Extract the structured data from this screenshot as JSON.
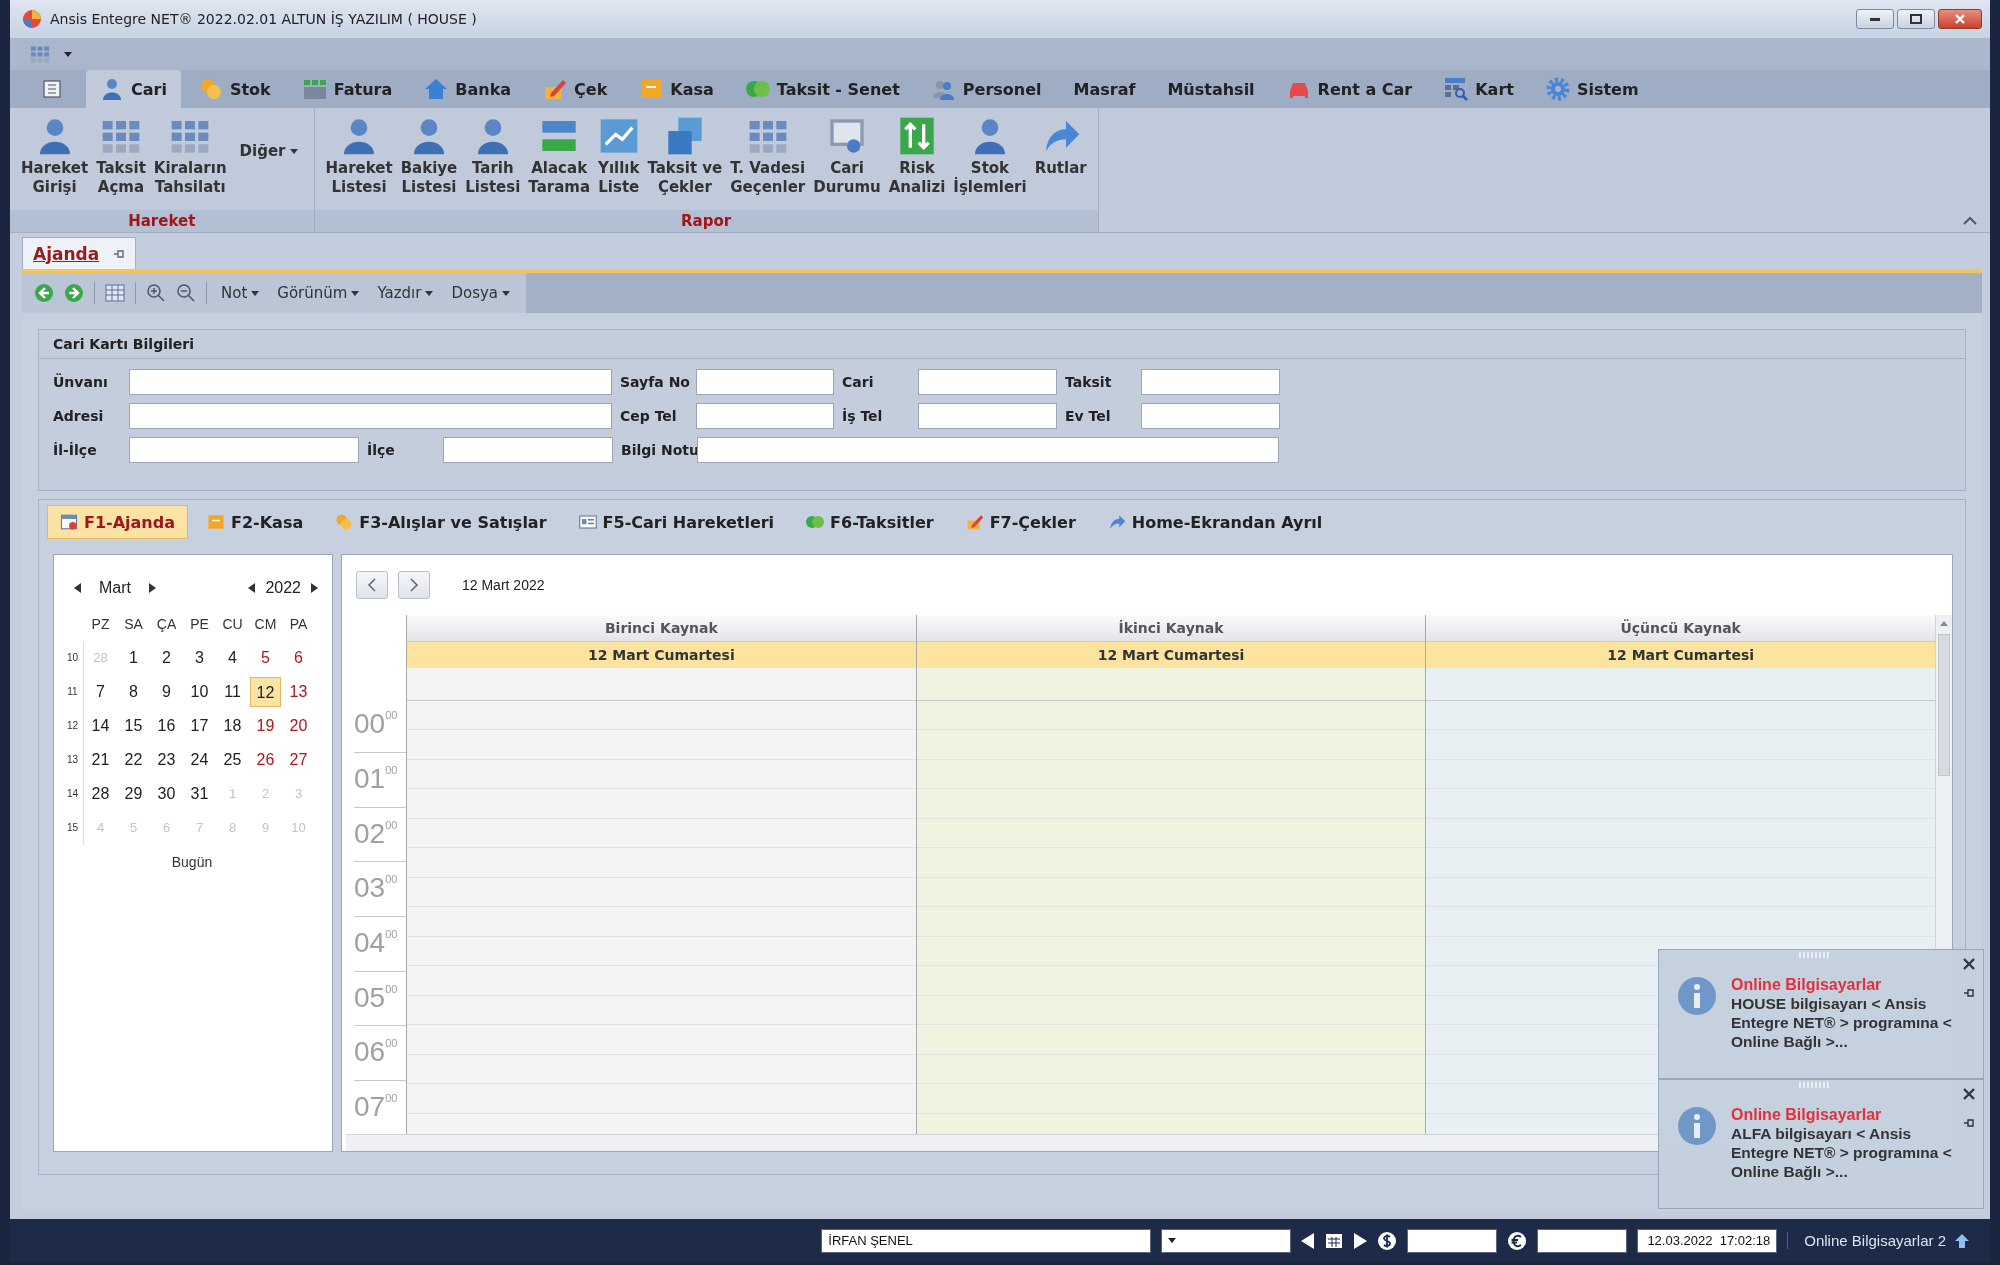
{
  "window": {
    "title": "Ansis Entegre NET® 2022.02.01 ALTUN İŞ YAZILIM ( HOUSE )"
  },
  "ribbon": {
    "tabs": [
      {
        "label": "Cari",
        "selected": true
      },
      {
        "label": "Stok",
        "selected": false
      },
      {
        "label": "Fatura",
        "selected": false
      },
      {
        "label": "Banka",
        "selected": false
      },
      {
        "label": "Çek",
        "selected": false
      },
      {
        "label": "Kasa",
        "selected": false
      },
      {
        "label": "Taksit - Senet",
        "selected": false
      },
      {
        "label": "Personel",
        "selected": false
      },
      {
        "label": "Masraf",
        "selected": false
      },
      {
        "label": "Müstahsil",
        "selected": false
      },
      {
        "label": "Rent a Car",
        "selected": false
      },
      {
        "label": "Kart",
        "selected": false
      },
      {
        "label": "Sistem",
        "selected": false
      }
    ],
    "groups": [
      {
        "label": "Hareket",
        "buttons": [
          {
            "kind": "large",
            "lines": [
              "Hareket",
              "Girişi"
            ]
          },
          {
            "kind": "large",
            "lines": [
              "Taksit",
              "Açma"
            ]
          },
          {
            "kind": "large",
            "lines": [
              "Kiraların",
              "Tahsilatı"
            ]
          },
          {
            "kind": "dropdown",
            "lines": [
              "Diğer"
            ]
          }
        ]
      },
      {
        "label": "Rapor",
        "buttons": [
          {
            "kind": "large",
            "lines": [
              "Hareket",
              "Listesi"
            ]
          },
          {
            "kind": "large",
            "lines": [
              "Bakiye",
              "Listesi"
            ]
          },
          {
            "kind": "large",
            "lines": [
              "Tarih",
              "Listesi"
            ]
          },
          {
            "kind": "large",
            "lines": [
              "Alacak",
              "Tarama"
            ]
          },
          {
            "kind": "large",
            "lines": [
              "Yıllık",
              "Liste"
            ]
          },
          {
            "kind": "large",
            "lines": [
              "Taksit ve",
              "Çekler"
            ]
          },
          {
            "kind": "large",
            "lines": [
              "T. Vadesi",
              "Geçenler"
            ]
          },
          {
            "kind": "large",
            "lines": [
              "Cari",
              "Durumu"
            ]
          },
          {
            "kind": "large",
            "lines": [
              "Risk",
              "Analizi"
            ]
          },
          {
            "kind": "large",
            "lines": [
              "Stok",
              "İşlemleri"
            ]
          },
          {
            "kind": "large",
            "lines": [
              "Rutlar"
            ]
          }
        ]
      }
    ]
  },
  "document_tab": {
    "label": "Ajanda",
    "selected": true
  },
  "toolbar": {
    "menus": [
      "Not",
      "Görünüm",
      "Yazdır",
      "Dosya"
    ]
  },
  "form": {
    "title": "Cari Kartı Bilgileri",
    "rows": [
      [
        {
          "label": "Ünvanı"
        },
        {
          "label": "Sayfa No"
        },
        {
          "label": "Cari"
        },
        {
          "label": "Taksit"
        }
      ],
      [
        {
          "label": "Adresi"
        },
        {
          "label": "Cep Tel"
        },
        {
          "label": "İş Tel"
        },
        {
          "label": "Ev Tel"
        }
      ],
      [
        {
          "label": "İl-İlçe",
          "sub": {
            "label": "İlçe"
          }
        },
        {
          "label": "Bilgi Notu"
        }
      ]
    ]
  },
  "tabs": [
    {
      "label": "F1-Ajanda",
      "selected": true
    },
    {
      "label": "F2-Kasa",
      "selected": false
    },
    {
      "label": "F3-Alışlar ve Satışlar",
      "selected": false
    },
    {
      "label": "F5-Cari Hareketleri",
      "selected": false
    },
    {
      "label": "F6-Taksitler",
      "selected": false
    },
    {
      "label": "F7-Çekler",
      "selected": false
    },
    {
      "label": "Home-Ekrandan Ayrıl",
      "selected": false
    }
  ],
  "calendar": {
    "month": "Mart",
    "year": "2022",
    "weekdays": [
      "PZ",
      "SA",
      "ÇA",
      "PE",
      "CU",
      "CM",
      "PA"
    ],
    "weeks": [
      {
        "number": "10",
        "days": [
          {
            "d": "28",
            "kind": "other",
            "selected": false
          },
          {
            "d": "1",
            "kind": "normal",
            "selected": false
          },
          {
            "d": "2",
            "kind": "normal",
            "selected": false
          },
          {
            "d": "3",
            "kind": "normal",
            "selected": false
          },
          {
            "d": "4",
            "kind": "normal",
            "selected": false
          },
          {
            "d": "5",
            "kind": "weekend",
            "selected": false
          },
          {
            "d": "6",
            "kind": "weekend",
            "selected": false
          }
        ]
      },
      {
        "number": "11",
        "days": [
          {
            "d": "7",
            "kind": "normal",
            "selected": false
          },
          {
            "d": "8",
            "kind": "normal",
            "selected": false
          },
          {
            "d": "9",
            "kind": "normal",
            "selected": false
          },
          {
            "d": "10",
            "kind": "normal",
            "selected": false
          },
          {
            "d": "11",
            "kind": "normal",
            "selected": false
          },
          {
            "d": "12",
            "kind": "normal",
            "selected": true
          },
          {
            "d": "13",
            "kind": "weekend",
            "selected": false
          }
        ]
      },
      {
        "number": "12",
        "days": [
          {
            "d": "14",
            "kind": "normal",
            "selected": false
          },
          {
            "d": "15",
            "kind": "normal",
            "selected": false
          },
          {
            "d": "16",
            "kind": "normal",
            "selected": false
          },
          {
            "d": "17",
            "kind": "normal",
            "selected": false
          },
          {
            "d": "18",
            "kind": "normal",
            "selected": false
          },
          {
            "d": "19",
            "kind": "weekend",
            "selected": false
          },
          {
            "d": "20",
            "kind": "weekend",
            "selected": false
          }
        ]
      },
      {
        "number": "13",
        "days": [
          {
            "d": "21",
            "kind": "normal",
            "selected": false
          },
          {
            "d": "22",
            "kind": "normal",
            "selected": false
          },
          {
            "d": "23",
            "kind": "normal",
            "selected": false
          },
          {
            "d": "24",
            "kind": "normal",
            "selected": false
          },
          {
            "d": "25",
            "kind": "normal",
            "selected": false
          },
          {
            "d": "26",
            "kind": "weekend",
            "selected": false
          },
          {
            "d": "27",
            "kind": "weekend",
            "selected": false
          }
        ]
      },
      {
        "number": "14",
        "days": [
          {
            "d": "28",
            "kind": "normal",
            "selected": false
          },
          {
            "d": "29",
            "kind": "normal",
            "selected": false
          },
          {
            "d": "30",
            "kind": "normal",
            "selected": false
          },
          {
            "d": "31",
            "kind": "normal",
            "selected": false
          },
          {
            "d": "1",
            "kind": "other",
            "selected": false
          },
          {
            "d": "2",
            "kind": "other",
            "selected": false
          },
          {
            "d": "3",
            "kind": "other",
            "selected": false
          }
        ]
      },
      {
        "number": "15",
        "days": [
          {
            "d": "4",
            "kind": "other",
            "selected": false
          },
          {
            "d": "5",
            "kind": "other",
            "selected": false
          },
          {
            "d": "6",
            "kind": "other",
            "selected": false
          },
          {
            "d": "7",
            "kind": "other",
            "selected": false
          },
          {
            "d": "8",
            "kind": "other",
            "selected": false
          },
          {
            "d": "9",
            "kind": "other",
            "selected": false
          },
          {
            "d": "10",
            "kind": "other",
            "selected": false
          }
        ]
      }
    ],
    "today_button": "Bugün"
  },
  "scheduler": {
    "date": "12 Mart 2022",
    "resources": [
      {
        "name": "Birinci Kaynak",
        "date": "12 Mart Cumartesi",
        "color": "#f4f4f4"
      },
      {
        "name": "İkinci Kaynak",
        "date": "12 Mart Cumartesi",
        "color": "#eef4e0"
      },
      {
        "name": "Üçüncü Kaynak",
        "date": "12 Mart Cumartesi",
        "color": "#e8f0f4"
      }
    ],
    "hours": [
      {
        "hour": "00",
        "minutes": "00"
      },
      {
        "hour": "01",
        "minutes": "00"
      },
      {
        "hour": "02",
        "minutes": "00"
      },
      {
        "hour": "03",
        "minutes": "00"
      },
      {
        "hour": "04",
        "minutes": "00"
      },
      {
        "hour": "05",
        "minutes": "00"
      },
      {
        "hour": "06",
        "minutes": "00"
      },
      {
        "hour": "07",
        "minutes": "00"
      }
    ]
  },
  "notifications": [
    {
      "title": "Online Bilgisayarlar",
      "text": "HOUSE bilgisayarı < Ansis Entegre NET® > programına < Online Bağlı >..."
    },
    {
      "title": "Online Bilgisayarlar",
      "text": "ALFA bilgisayarı < Ansis Entegre NET® > programına < Online Bağlı >..."
    }
  ],
  "status_bar": {
    "user": "İRFAN ŞENEL",
    "datetime": "12.03.2022  17:02:18",
    "online": "Online Bilgisayarlar 2"
  }
}
